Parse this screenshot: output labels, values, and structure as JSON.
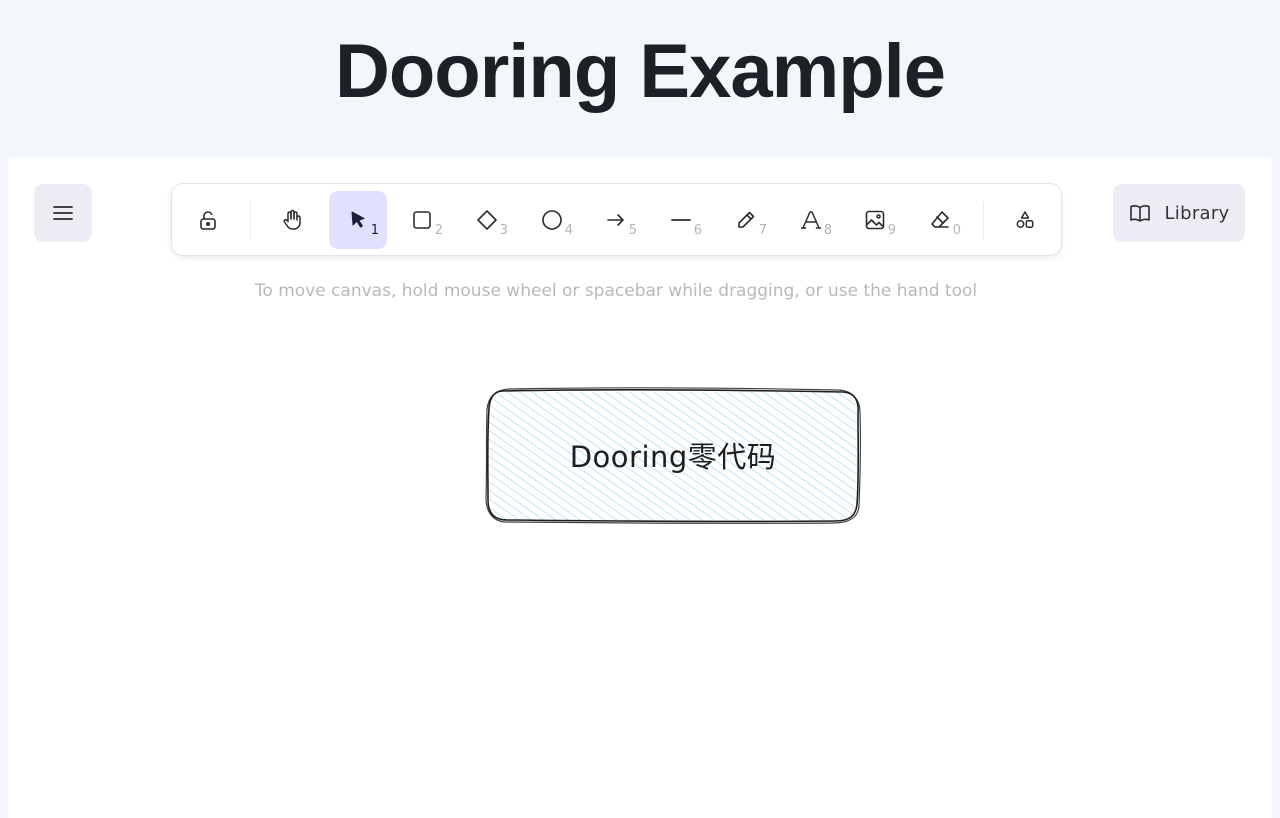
{
  "page": {
    "title": "Dooring Example"
  },
  "toolbar": {
    "tools": [
      {
        "name": "lock",
        "icon": "lock-open-icon",
        "key": ""
      },
      {
        "name": "hand",
        "icon": "hand-icon",
        "key": ""
      },
      {
        "name": "selection",
        "icon": "cursor-arrow-icon",
        "key": "1",
        "active": true
      },
      {
        "name": "rectangle",
        "icon": "square-icon",
        "key": "2"
      },
      {
        "name": "diamond",
        "icon": "diamond-icon",
        "key": "3"
      },
      {
        "name": "ellipse",
        "icon": "circle-icon",
        "key": "4"
      },
      {
        "name": "arrow",
        "icon": "arrow-right-icon",
        "key": "5"
      },
      {
        "name": "line",
        "icon": "line-icon",
        "key": "6"
      },
      {
        "name": "draw",
        "icon": "pencil-icon",
        "key": "7"
      },
      {
        "name": "text",
        "icon": "text-a-icon",
        "key": "8"
      },
      {
        "name": "image",
        "icon": "image-icon",
        "key": "9"
      },
      {
        "name": "eraser",
        "icon": "eraser-icon",
        "key": "0"
      },
      {
        "name": "more-shapes",
        "icon": "shapes-icon",
        "key": ""
      }
    ]
  },
  "library": {
    "label": "Library",
    "icon": "book-open-icon"
  },
  "hint": "To move canvas, hold mouse wheel or spacebar while dragging, or use the hand tool",
  "canvas": {
    "element": {
      "label": "Dooring零代码",
      "stroke": "#1e1e1e",
      "hatch": "#a5d3ee"
    }
  },
  "colors": {
    "accent": "#e1e0fd",
    "background": "#f3f6fa"
  }
}
